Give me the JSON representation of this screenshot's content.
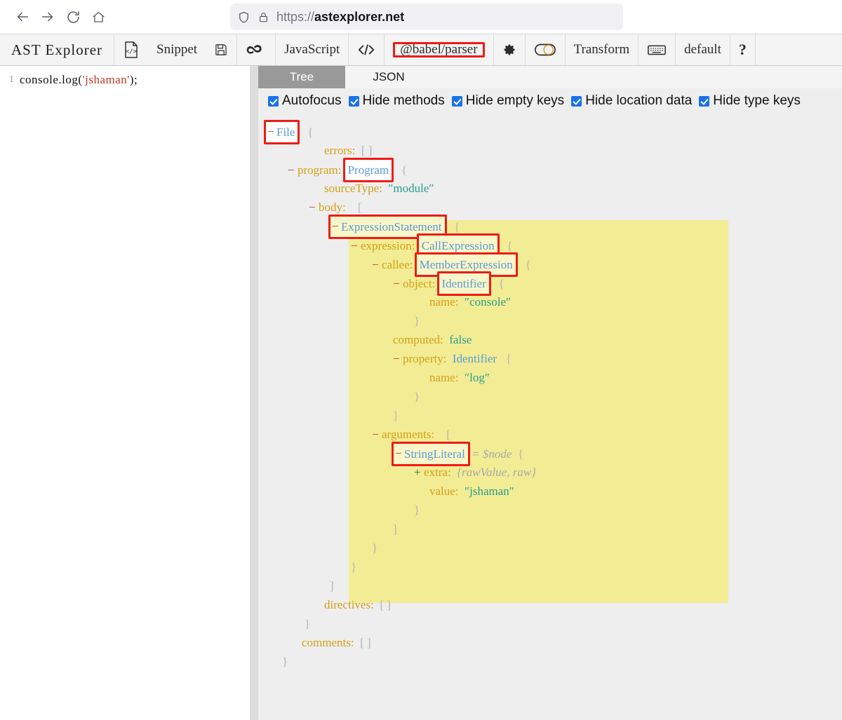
{
  "browser": {
    "back_icon": "arrow-left-icon",
    "forward_icon": "arrow-right-icon",
    "reload_icon": "reload-icon",
    "home_icon": "home-icon",
    "shield_icon": "shield-icon",
    "lock_icon": "lock-icon",
    "url_scheme": "https://",
    "url_domain": "astexplorer.net"
  },
  "toolbar": {
    "brand": "AST Explorer",
    "snippet_icon": "code-file-icon",
    "snippet_label": "Snippet",
    "save_icon": "save-floppy-icon",
    "infinity_icon": "infinity-cloud-icon",
    "language_label": "JavaScript",
    "code_icon": "angle-brackets-icon",
    "parser_label": "@babel/parser",
    "gear_icon": "gear-icon",
    "toggle_icon": "toggle-switch-icon",
    "transform_label": "Transform",
    "keyboard_icon": "keyboard-icon",
    "keymap_label": "default",
    "help_label": "?"
  },
  "editor": {
    "line_number": "1",
    "code_before": "console.log(",
    "code_string": "'jshaman'",
    "code_after": ");"
  },
  "ast": {
    "tabs": [
      {
        "label": "Tree",
        "active": true
      },
      {
        "label": "JSON",
        "active": false
      }
    ],
    "options": [
      {
        "label": "Autofocus",
        "checked": true
      },
      {
        "label": "Hide methods",
        "checked": true
      },
      {
        "label": "Hide empty keys",
        "checked": true
      },
      {
        "label": "Hide location data",
        "checked": true
      },
      {
        "label": "Hide type keys",
        "checked": true
      }
    ],
    "colors": {
      "highlight": "#f2ec94",
      "annotation_box": "#ed1c16",
      "pane_background": "#eeeeee",
      "type_text": "#5b9bd5",
      "key_text": "#d4a017",
      "string_value": "#2a9d8f"
    },
    "tree": {
      "file_sign": "−",
      "file_type": "File",
      "file_brace": "{",
      "errors_key": "errors:",
      "errors_value": "[ ]",
      "program_sign": "−",
      "program_key": "program:",
      "program_type": "Program",
      "program_brace": "{",
      "sourcetype_key": "sourceType:",
      "sourcetype_value": "″module″",
      "body_sign": "−",
      "body_key": "body:",
      "body_bracket": "[",
      "exprstmt_sign": "−",
      "exprstmt_type": "ExpressionStatement",
      "exprstmt_brace": "{",
      "expression_sign": "−",
      "expression_key": "expression:",
      "expression_type": "CallExpression",
      "expression_brace": "{",
      "callee_sign": "−",
      "callee_key": "callee:",
      "callee_type": "MemberExpression",
      "callee_brace": "{",
      "object_sign": "−",
      "object_key": "object:",
      "object_type": "Identifier",
      "object_brace": "{",
      "object_name_key": "name:",
      "object_name_value": "″console″",
      "object_close": "}",
      "computed_key": "computed:",
      "computed_value": "false",
      "property_sign": "−",
      "property_key": "property:",
      "property_type": "Identifier",
      "property_brace": "{",
      "property_name_key": "name:",
      "property_name_value": "″log″",
      "property_close": "}",
      "callee_close": "}",
      "arguments_sign": "−",
      "arguments_key": "arguments:",
      "arguments_bracket": "[",
      "stringliteral_sign": "−",
      "stringliteral_type": "StringLiteral",
      "stringliteral_eq": "= $node",
      "stringliteral_brace": "{",
      "extra_sign": "+",
      "extra_key": "extra:",
      "extra_value": "{rawValue, raw}",
      "value_key": "value:",
      "value_value": "″jshaman″",
      "stringliteral_close": "}",
      "arguments_close": "]",
      "expression_close": "}",
      "exprstmt_close": "}",
      "body_close": "]",
      "directives_key": "directives:",
      "directives_value": "[ ]",
      "program_close": "}",
      "comments_key": "comments:",
      "comments_value": "[ ]",
      "file_close": "}"
    }
  }
}
